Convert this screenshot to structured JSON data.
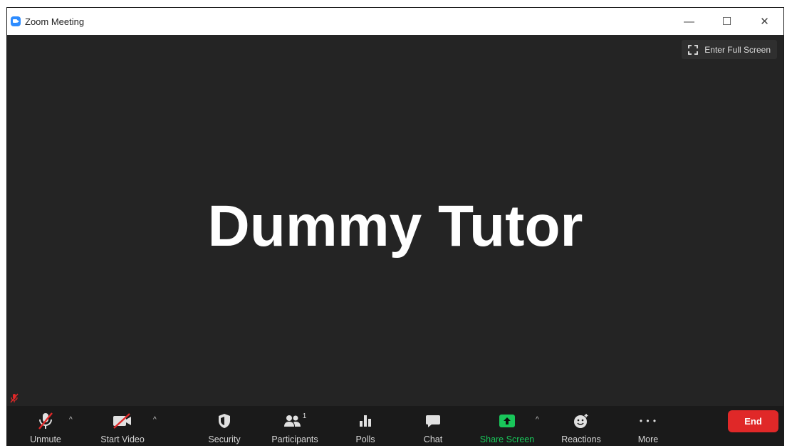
{
  "window": {
    "title": "Zoom Meeting",
    "controls": {
      "minimize": "—",
      "maximize": "☐",
      "close": "✕"
    }
  },
  "video": {
    "fullscreen_label": "Enter Full Screen",
    "participant_name": "Dummy Tutor"
  },
  "toolbar": {
    "unmute": "Unmute",
    "start_video": "Start Video",
    "security": "Security",
    "participants": "Participants",
    "participant_count": "1",
    "polls": "Polls",
    "chat": "Chat",
    "share_screen": "Share Screen",
    "reactions": "Reactions",
    "more": "More",
    "end": "End",
    "more_glyph": "• • •",
    "caret": "^"
  },
  "colors": {
    "background": "#242424",
    "toolbar": "#1a1a1a",
    "share_green": "#19c65a",
    "end_red": "#e02828",
    "zoom_blue": "#2d8cff",
    "muted_red": "#e02828"
  }
}
